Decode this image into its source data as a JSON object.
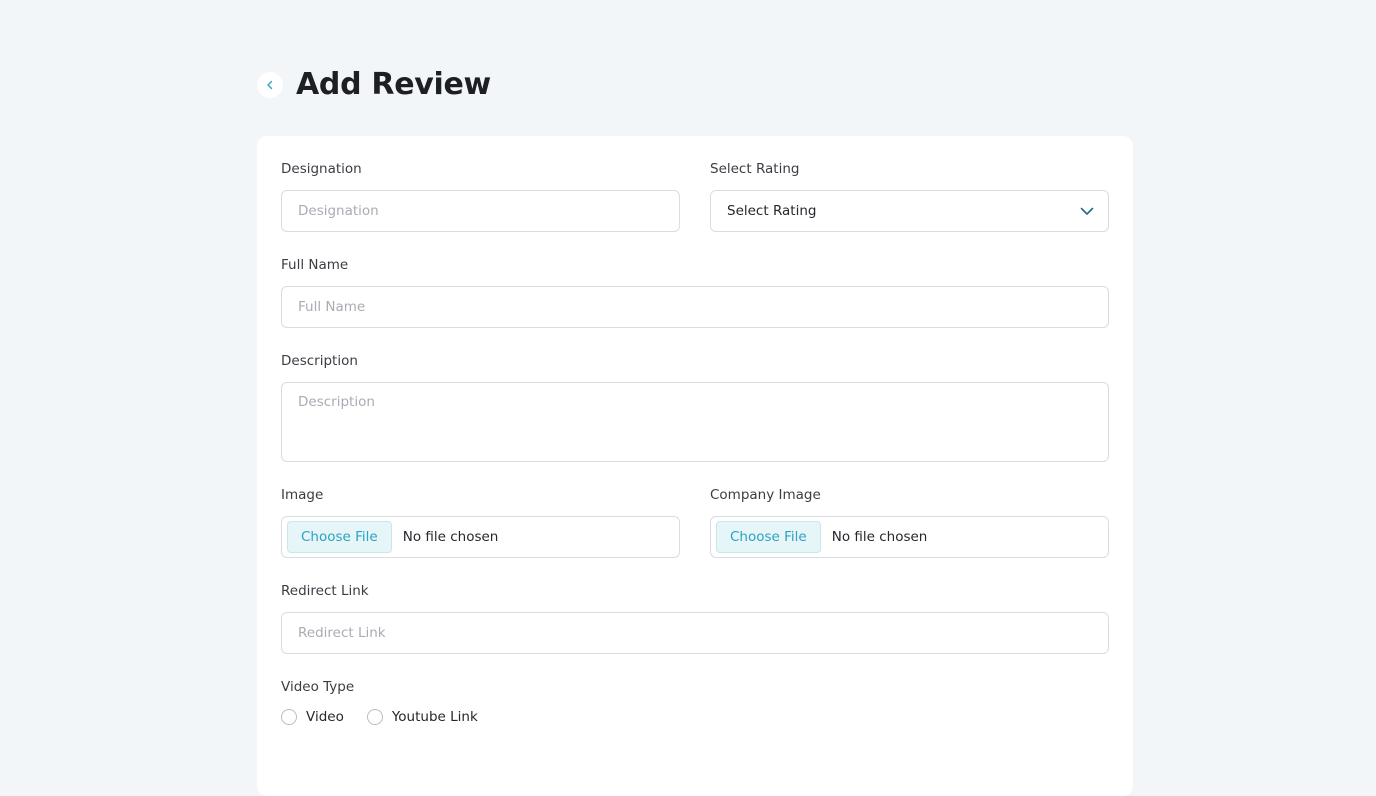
{
  "header": {
    "title": "Add Review",
    "back_icon": "chevron-left-icon"
  },
  "form": {
    "designation": {
      "label": "Designation",
      "placeholder": "Designation"
    },
    "rating": {
      "label": "Select Rating",
      "selected": "Select Rating",
      "icon": "chevron-down-icon"
    },
    "full_name": {
      "label": "Full Name",
      "placeholder": "Full Name"
    },
    "description": {
      "label": "Description",
      "placeholder": "Description"
    },
    "image": {
      "label": "Image",
      "button": "Choose File",
      "status": "No file chosen"
    },
    "company_image": {
      "label": "Company Image",
      "button": "Choose File",
      "status": "No file chosen"
    },
    "redirect_link": {
      "label": "Redirect Link",
      "placeholder": "Redirect Link"
    },
    "video_type": {
      "label": "Video Type",
      "options": [
        "Video",
        "Youtube Link"
      ]
    }
  },
  "colors": {
    "accent": "#2aa3c2",
    "background": "#f2f6f9",
    "border": "#d9dde1"
  }
}
